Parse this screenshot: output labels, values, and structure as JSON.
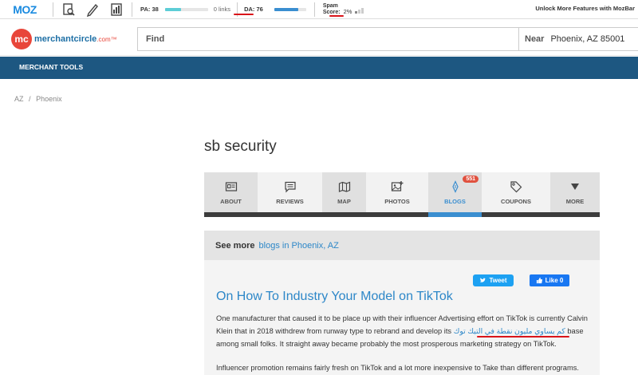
{
  "mozbar": {
    "logo": "MOZ",
    "pa_label": "PA: 38",
    "pa_fill": 0.38,
    "links_label": "0 links",
    "da_label": "DA: 76",
    "da_fill": 0.76,
    "spam_label_1": "Spam",
    "spam_label_2": "Score:",
    "spam_value": "2%",
    "unlock": "Unlock More Features with MozBar",
    "accent": "#1b8be0"
  },
  "header": {
    "logo_initials": "mc",
    "logo_text": "merchantcircle",
    "logo_suffix": ".com™",
    "find_label": "Find",
    "near_label": "Near",
    "near_value": "Phoenix, AZ 85001"
  },
  "nav": {
    "merchant_tools": "MERCHANT TOOLS"
  },
  "breadcrumb": {
    "state": "AZ",
    "sep": "/",
    "city": "Phoenix"
  },
  "page_title": "sb security",
  "tabs": [
    {
      "label": "ABOUT",
      "icon": "id-card-icon"
    },
    {
      "label": "REVIEWS",
      "icon": "chat-icon"
    },
    {
      "label": "MAP",
      "icon": "map-icon"
    },
    {
      "label": "PHOTOS",
      "icon": "photo-add-icon"
    },
    {
      "label": "BLOGS",
      "icon": "pen-icon",
      "badge": "551"
    },
    {
      "label": "COUPONS",
      "icon": "tag-icon"
    },
    {
      "label": "MORE",
      "icon": "triangle-down-icon"
    }
  ],
  "see_more": {
    "label": "See more",
    "link": "blogs in Phoenix, AZ"
  },
  "post": {
    "tweet": "Tweet",
    "like": "Like 0",
    "title": "On How To Industry Your Model on TikTok",
    "body_1": "One manufacturer that caused it to be place up with their influencer Advertising effort on TikTok is currently Calvin Klein that in 2018 withdrew from runway type to rebrand and develop its",
    "arabic_link": "كم يساوي مليون نقطة في التيك توك",
    "body_2": "base among small folks. It straight away became probably the most prosperous marketing strategy on TikTok.",
    "body_3": "Influencer promotion remains fairly fresh on TikTok and a lot more inexpensive to Take than different programs."
  },
  "colors": {
    "nav_bg": "#1d5781",
    "link_blue": "#2d87c8",
    "badge_red": "#e0513f",
    "annotation_red": "#d9141a"
  }
}
